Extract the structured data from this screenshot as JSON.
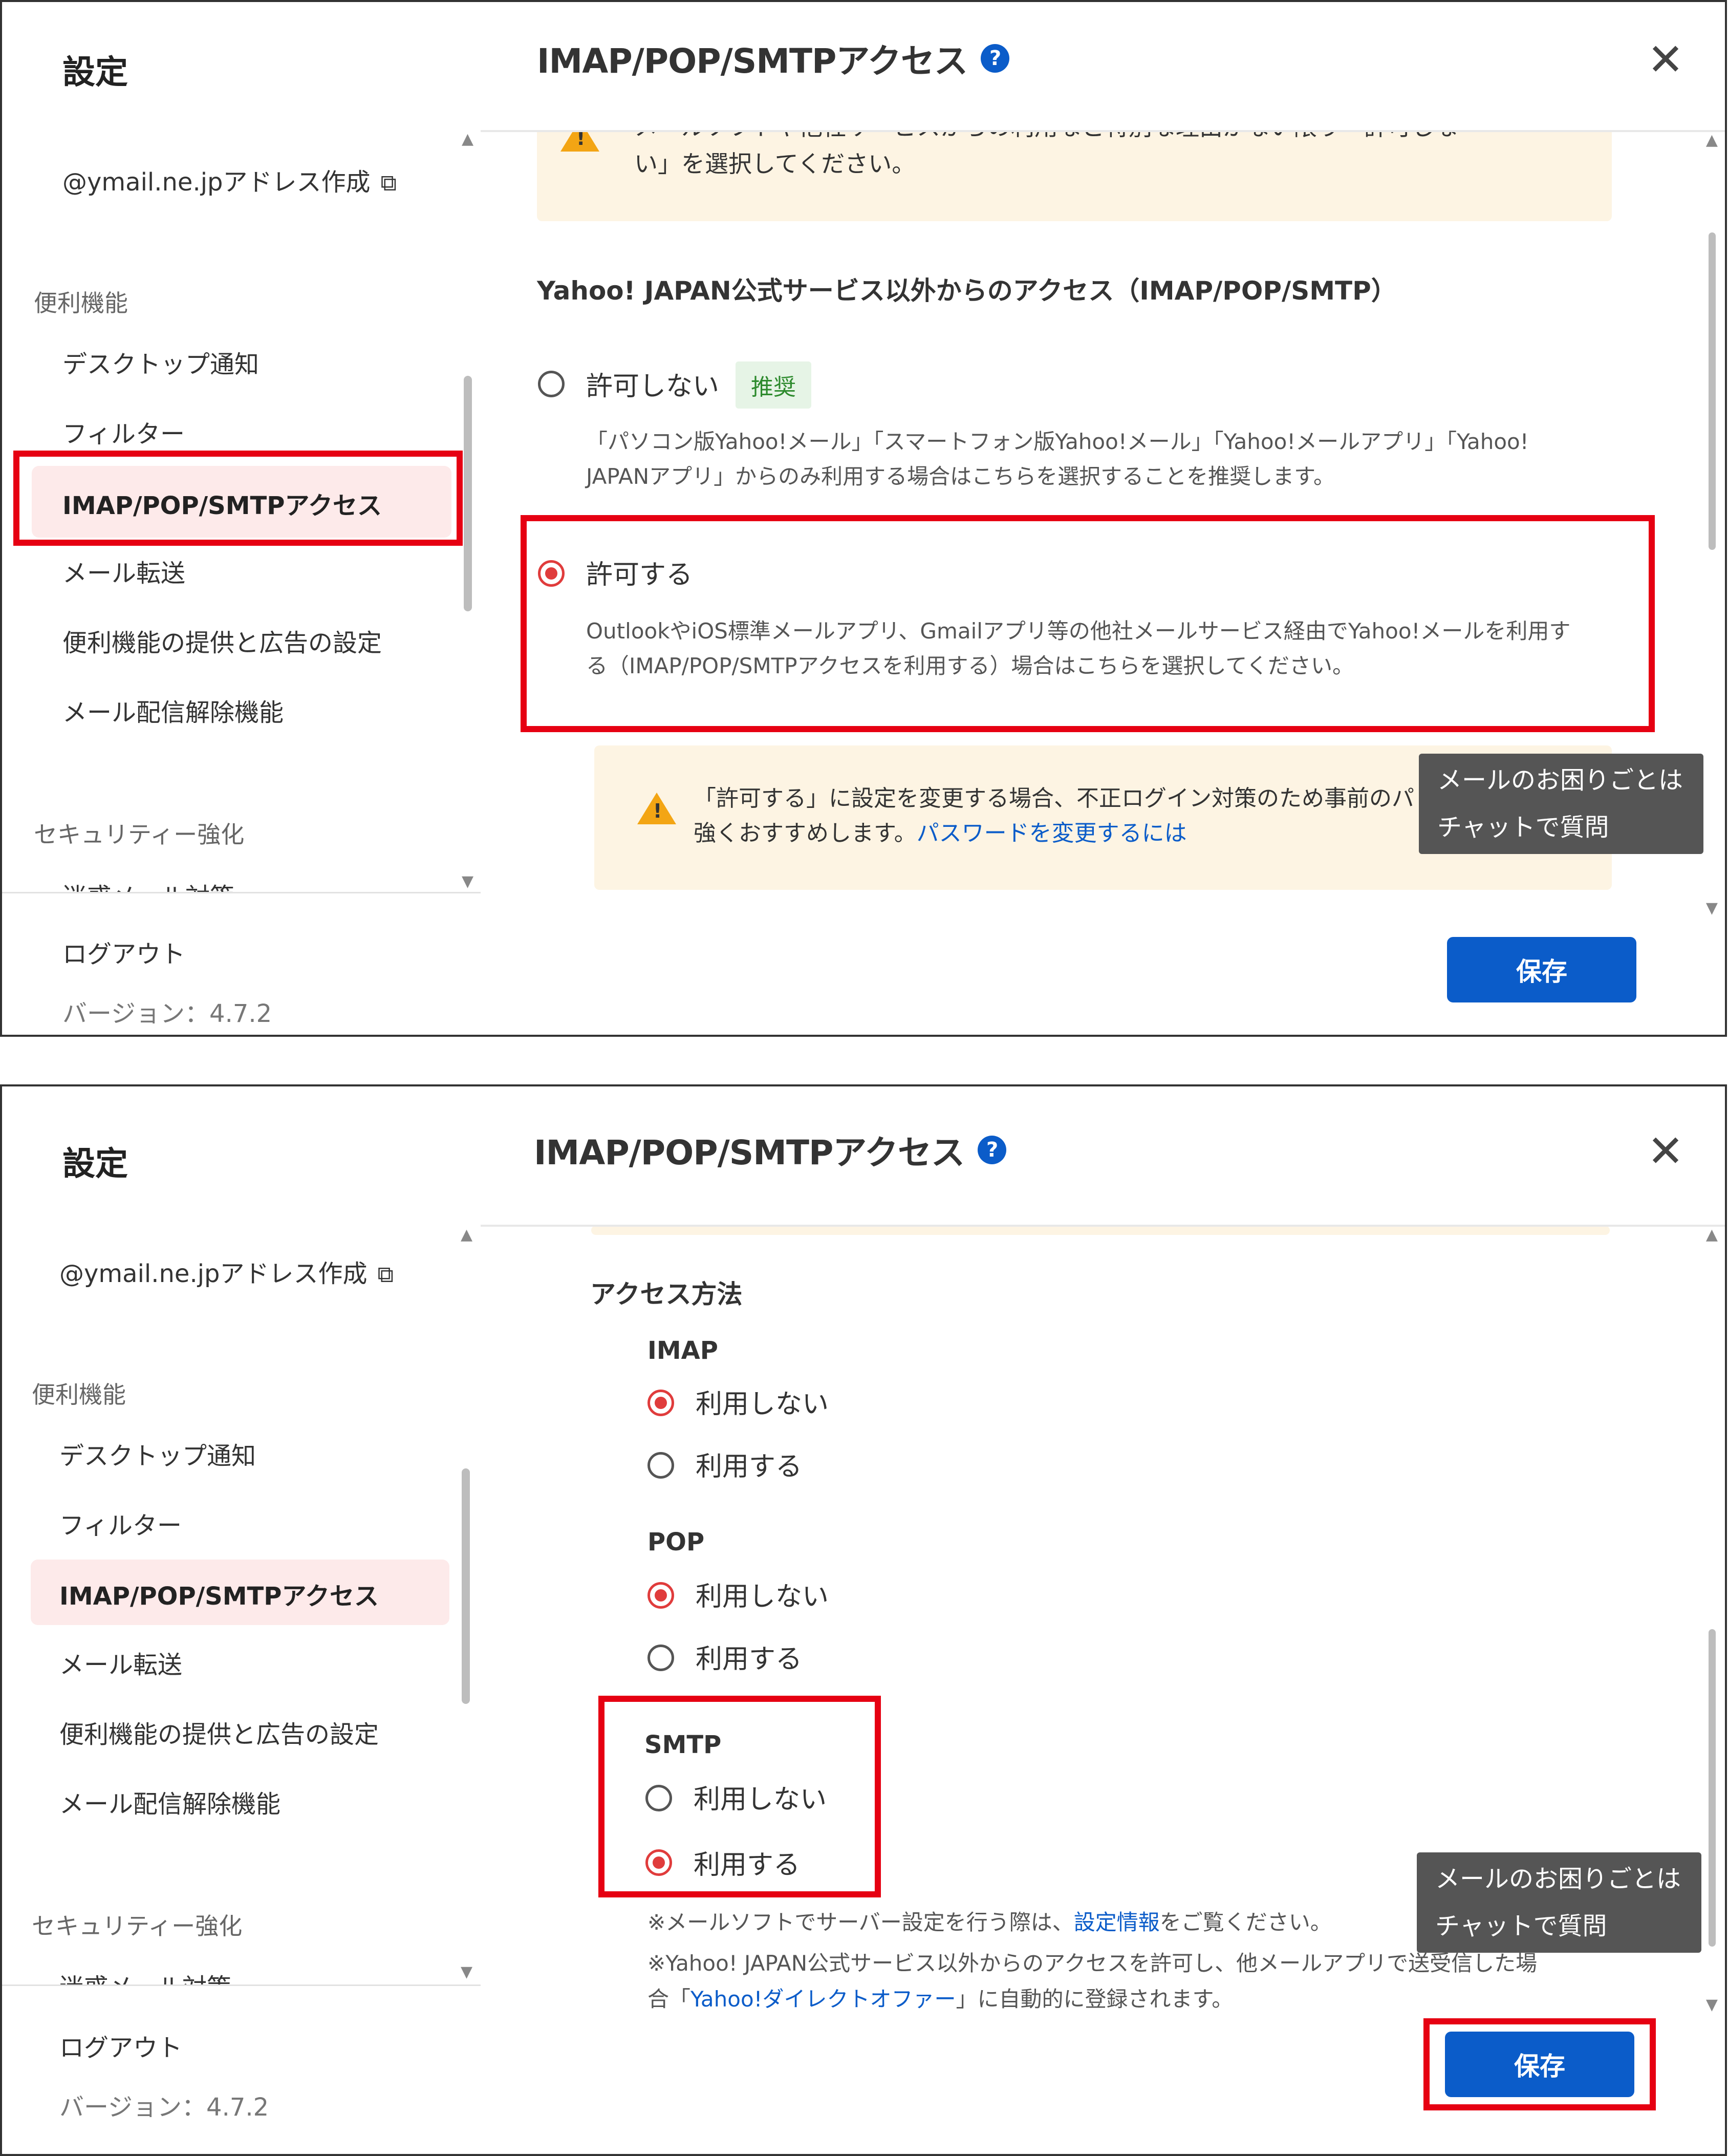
{
  "sidebar": {
    "title": "設定",
    "address_link": "@ymail.ne.jpアドレス作成",
    "section_convenience": "便利機能",
    "items": [
      "デスクトップ通知",
      "フィルター",
      "IMAP/POP/SMTPアクセス",
      "メール転送",
      "便利機能の提供と広告の設定",
      "メール配信解除機能"
    ],
    "section_security": "セキュリティー強化",
    "cut_item": "迷惑メール対策",
    "logout": "ログアウト",
    "version": "バージョン：4.7.2"
  },
  "header": {
    "title": "IMAP/POP/SMTPアクセス",
    "help_glyph": "?",
    "close_glyph": "✕"
  },
  "panel1": {
    "warn_top_line1": "メールソフトや他社サービスからの利用など特別な理由がない限り「許可しな",
    "warn_top_line2": "い」を選択してください。",
    "section_heading": "Yahoo! JAPAN公式サービス以外からのアクセス（IMAP/POP/SMTP）",
    "option_deny": "許可しない",
    "recommended_badge": "推奨",
    "deny_desc_line1": "「パソコン版Yahoo!メール」「スマートフォン版Yahoo!メール」「Yahoo!メールアプリ」「Yahoo!",
    "deny_desc_line2": "JAPANアプリ」からのみ利用する場合はこちらを選択することを推奨します。",
    "option_allow": "許可する",
    "allow_desc_line1": "OutlookやiOS標準メールアプリ、Gmailアプリ等の他社メールサービス経由でYahoo!メールを利用す",
    "allow_desc_line2": "る（IMAP/POP/SMTPアクセスを利用する）場合はこちらを選択してください。",
    "warn_bottom_line1": "「許可する」に設定を変更する場合、不正ログイン対策のため事前のパ",
    "warn_bottom_line2_prefix": "強くおすすめします。",
    "warn_bottom_link": "パスワードを変更するには"
  },
  "panel2": {
    "access_method": "アクセス方法",
    "imap": "IMAP",
    "pop": "POP",
    "smtp": "SMTP",
    "not_use": "利用しない",
    "use": "利用する",
    "note1_prefix": "※メールソフトでサーバー設定を行う際は、",
    "note1_link": "設定情報",
    "note1_suffix": "をご覧ください。",
    "note2_line1": "※Yahoo! JAPAN公式サービス以外からのアクセスを許可し、他メールアプリで送受信した場",
    "note2_prefix": "合「",
    "note2_link": "Yahoo!ダイレクトオファー",
    "note2_suffix": "」に自動的に登録されます。"
  },
  "chat": {
    "line1": "メールのお困りごとは",
    "line2": "チャットで質問"
  },
  "save_label": "保存",
  "colors": {
    "accent": "#0b5cc9",
    "highlight": "#e60012",
    "radio_on": "#e03c3c",
    "active_bg": "#fdeaea",
    "warn_bg": "#fdf4e3"
  }
}
